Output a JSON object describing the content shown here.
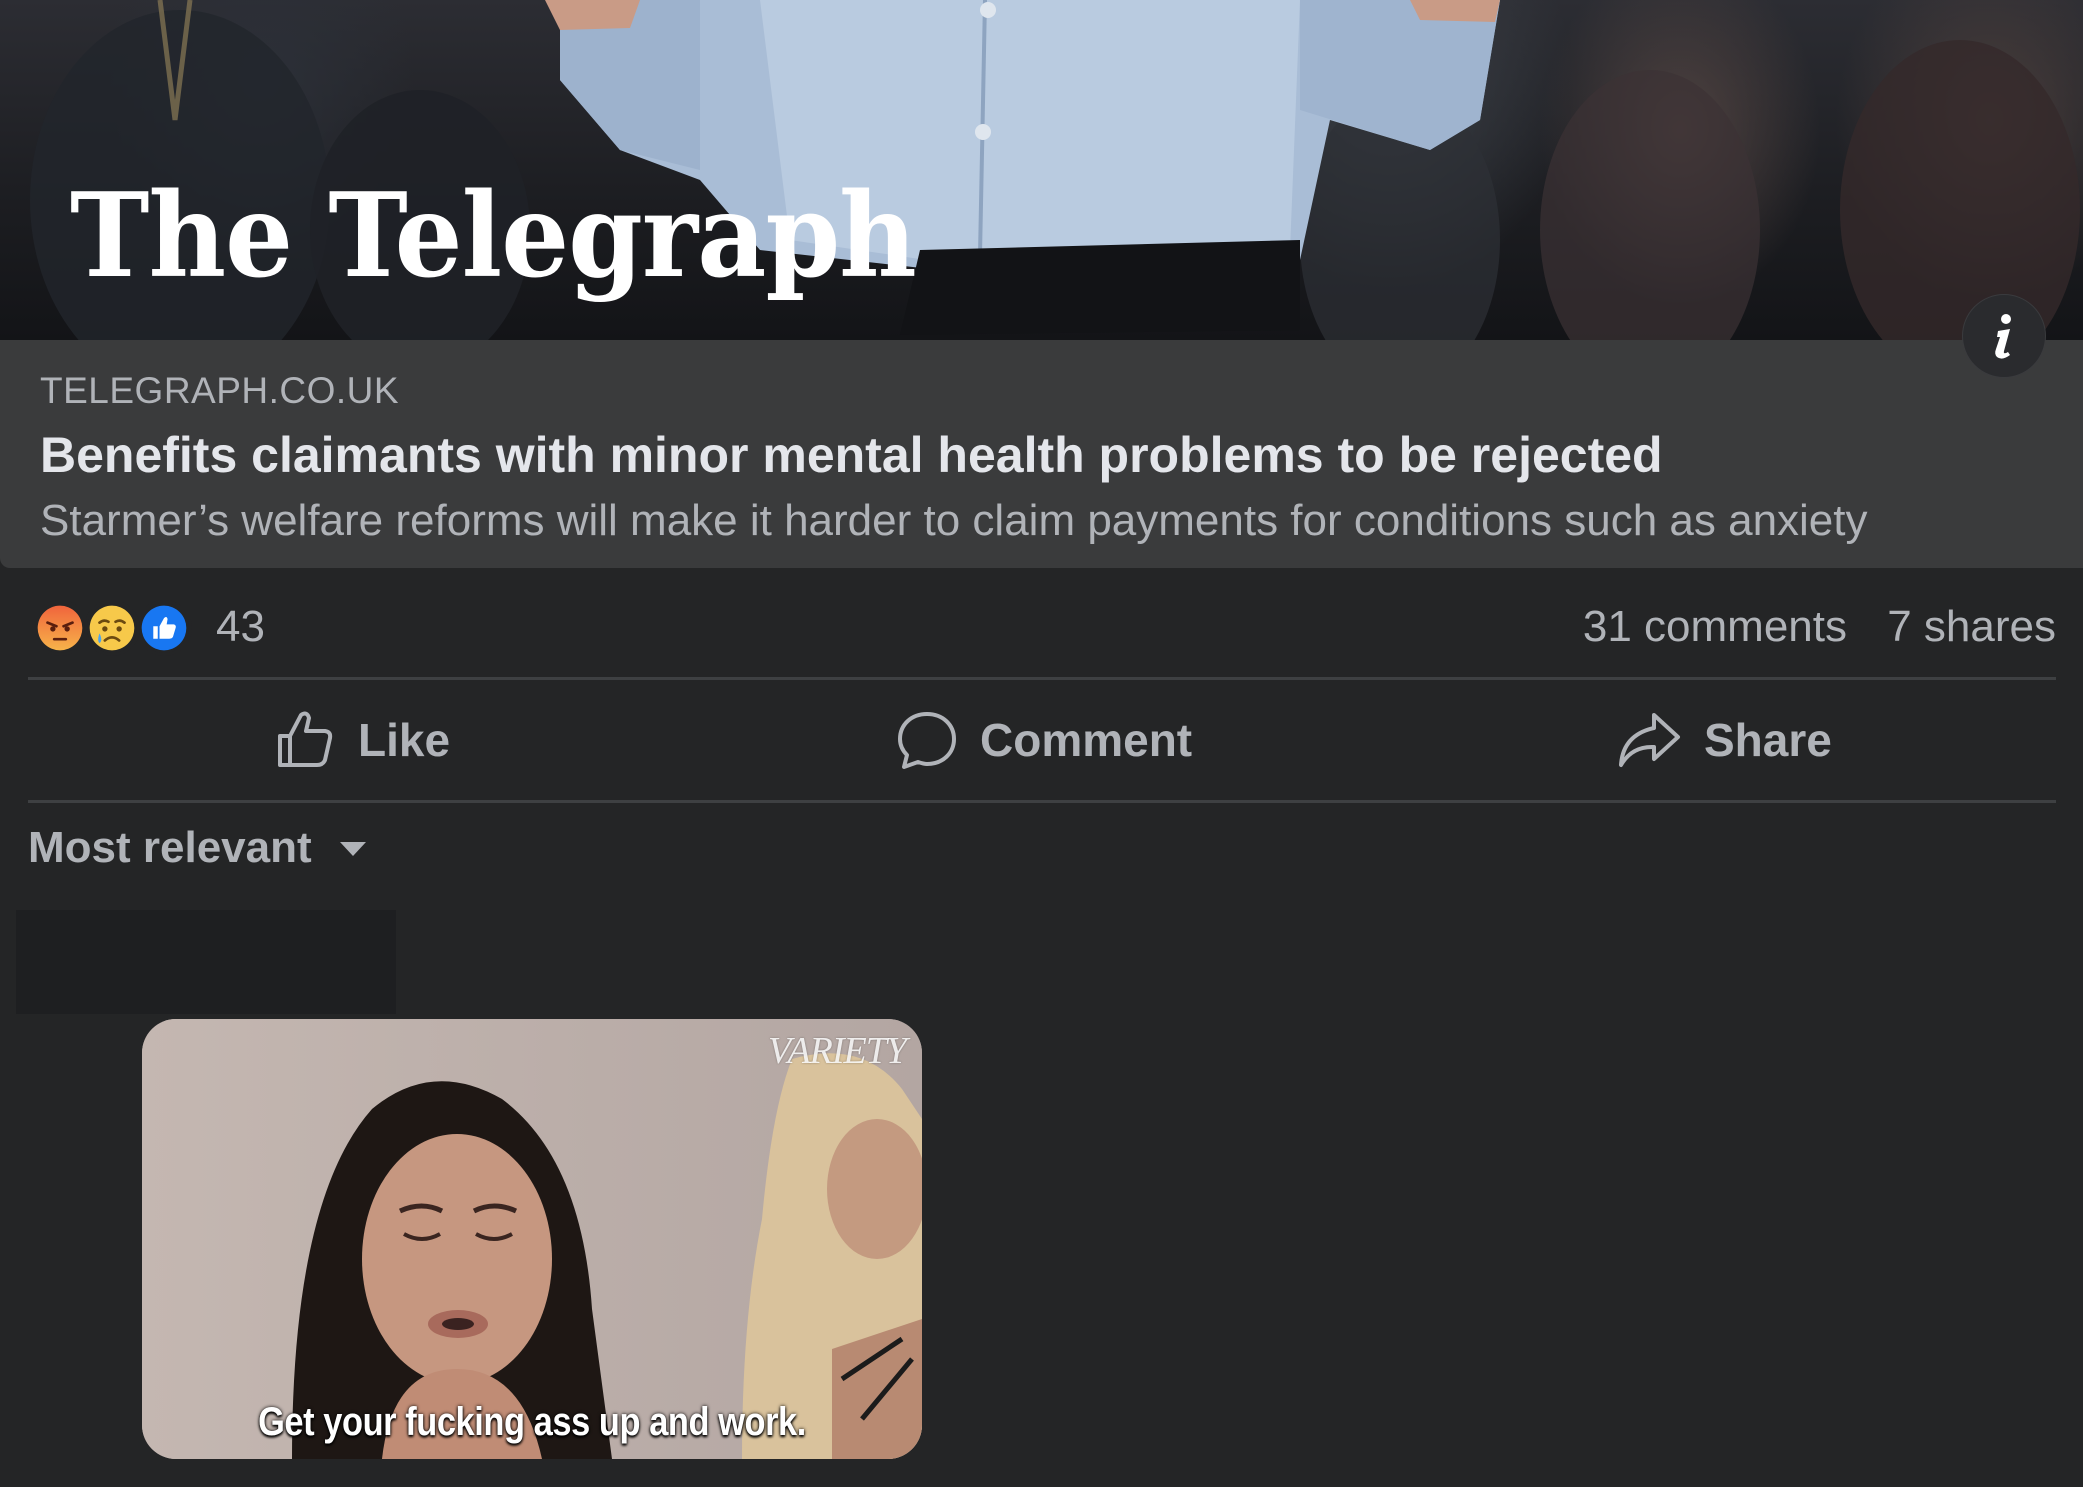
{
  "hero": {
    "logo_text": "The Telegraph"
  },
  "link_preview": {
    "domain": "TELEGRAPH.CO.UK",
    "title": "Benefits claimants with minor mental health problems to be rejected",
    "description": "Starmer’s welfare reforms will make it harder to claim payments for conditions such as anxiety"
  },
  "stats": {
    "reaction_icons": [
      "angry-reaction-icon",
      "sad-reaction-icon",
      "like-reaction-icon"
    ],
    "reaction_count": "43",
    "comments": "31 comments",
    "shares": "7 shares"
  },
  "actions": {
    "like": "Like",
    "comment": "Comment",
    "share": "Share"
  },
  "sort": {
    "label": "Most relevant"
  },
  "comment": {
    "gif_caption": "Get your fucking ass up and work.",
    "gif_watermark": "VARIETY"
  },
  "colors": {
    "background": "#242526",
    "card": "#3a3b3c",
    "primary_text": "#e4e6eb",
    "secondary_text": "#b0b3b8",
    "like_blue": "#1877f2",
    "angry_orange": "#f0643c",
    "sad_yellow": "#f7c94a"
  }
}
